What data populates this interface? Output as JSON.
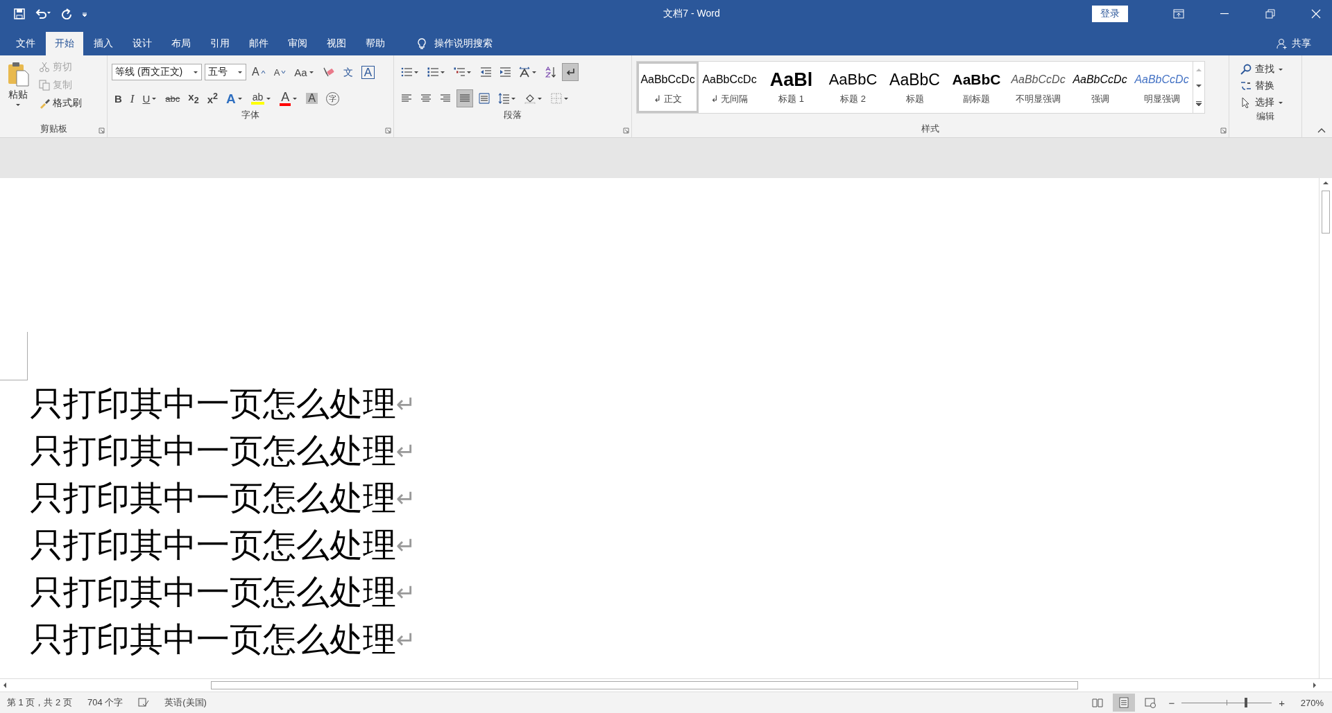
{
  "title_bar": {
    "title": "文档7  -  Word",
    "sign_in": "登录"
  },
  "tabs": [
    {
      "label": "文件",
      "selected": false
    },
    {
      "label": "开始",
      "selected": true
    },
    {
      "label": "插入",
      "selected": false
    },
    {
      "label": "设计",
      "selected": false
    },
    {
      "label": "布局",
      "selected": false
    },
    {
      "label": "引用",
      "selected": false
    },
    {
      "label": "邮件",
      "selected": false
    },
    {
      "label": "审阅",
      "selected": false
    },
    {
      "label": "视图",
      "selected": false
    },
    {
      "label": "帮助",
      "selected": false
    }
  ],
  "tell_me": {
    "placeholder": "操作说明搜索"
  },
  "share": "共享",
  "clipboard": {
    "paste": "粘贴",
    "small": [
      {
        "kind": "cut",
        "label": "剪切",
        "disabled": true
      },
      {
        "kind": "copy",
        "label": "复制",
        "disabled": true
      },
      {
        "kind": "painter",
        "label": "格式刷",
        "disabled": false
      }
    ],
    "group_label": "剪贴板"
  },
  "font": {
    "font_name": "等线 (西文正文)",
    "font_size": "五号",
    "group_label": "字体",
    "row1": [
      {
        "kind": "grow",
        "glyph": "A"
      },
      {
        "kind": "shrink",
        "glyph": "A"
      },
      {
        "kind": "case",
        "glyph": "Aa",
        "dropdown": true
      },
      {
        "kind": "clear"
      },
      {
        "kind": "phonetic",
        "glyph": "文"
      },
      {
        "kind": "boxed",
        "glyph": "A"
      }
    ],
    "row2": [
      {
        "kind": "bold",
        "glyph": "B"
      },
      {
        "kind": "italic",
        "glyph": "I"
      },
      {
        "kind": "underline",
        "glyph": "U",
        "dropdown": true
      },
      {
        "kind": "strike",
        "glyph": "abc"
      },
      {
        "kind": "script",
        "glyph": "x$_{2}$"
      },
      {
        "kind": "script",
        "glyph": "x$^{2}$"
      },
      {
        "kind": "effect",
        "glyph": "A",
        "dropdown": true
      },
      {
        "kind": "highlight",
        "glyph": "ab",
        "color": "#ffff00",
        "dropdown": true
      },
      {
        "kind": "fontcolor",
        "glyph": "A",
        "color": "#ff0000",
        "dropdown": true
      },
      {
        "kind": "shade",
        "glyph": "A"
      },
      {
        "kind": "circled",
        "glyph": "字"
      }
    ]
  },
  "paragraph": {
    "group_label": "段落",
    "row1": [
      {
        "kind": "bullets",
        "dropdown": true,
        "on": false
      },
      {
        "kind": "numbering",
        "dropdown": true,
        "on": false
      },
      {
        "kind": "multilevel",
        "dropdown": true,
        "on": false
      },
      {
        "kind": "outdent",
        "dropdown": false,
        "on": false
      },
      {
        "kind": "indent",
        "dropdown": false,
        "on": false
      },
      {
        "kind": "asian",
        "dropdown": true,
        "on": false
      },
      {
        "kind": "sort",
        "dropdown": false,
        "on": false
      },
      {
        "kind": "marks",
        "dropdown": false,
        "on": true
      }
    ],
    "row2": [
      {
        "kind": "left",
        "dropdown": false,
        "on": false
      },
      {
        "kind": "center",
        "dropdown": false,
        "on": false
      },
      {
        "kind": "right",
        "dropdown": false,
        "on": false
      },
      {
        "kind": "justify",
        "dropdown": false,
        "on": true
      },
      {
        "kind": "distributed",
        "dropdown": false,
        "on": false
      },
      {
        "kind": "spacing",
        "dropdown": true,
        "on": false
      },
      {
        "kind": "shading",
        "dropdown": true,
        "on": false
      },
      {
        "kind": "borders",
        "dropdown": true,
        "on": false
      }
    ]
  },
  "styles": {
    "group_label": "样式",
    "items": [
      {
        "kind": "normal",
        "sample": "AaBbCcDc",
        "label": "正文",
        "mark": "↲",
        "selected": true
      },
      {
        "kind": "nospacing",
        "sample": "AaBbCcDc",
        "label": "无间隔",
        "mark": "↲",
        "selected": false
      },
      {
        "kind": "heading1",
        "sample": "AaBl",
        "label": "标题 1",
        "selected": false
      },
      {
        "kind": "heading2",
        "sample": "AaBbC",
        "label": "标题 2",
        "selected": false
      },
      {
        "kind": "title",
        "sample": "AaBbC",
        "label": "标题",
        "selected": false
      },
      {
        "kind": "subtitle",
        "sample": "AaBbC",
        "label": "副标题",
        "selected": false
      },
      {
        "kind": "subtle",
        "sample": "AaBbCcDc",
        "label": "不明显强调",
        "selected": false
      },
      {
        "kind": "emphasis",
        "sample": "AaBbCcDc",
        "label": "强调",
        "selected": false
      },
      {
        "kind": "intense",
        "sample": "AaBbCcDc",
        "label": "明显强调",
        "selected": false
      }
    ]
  },
  "editing": {
    "group_label": "编辑",
    "items": [
      {
        "kind": "find",
        "label": "查找",
        "dropdown": true
      },
      {
        "kind": "replace",
        "label": "替换",
        "dropdown": false
      },
      {
        "kind": "select",
        "label": "选择",
        "dropdown": true
      }
    ]
  },
  "document": {
    "lines": [
      {
        "text": "只打印其中一页怎么处理",
        "mark": "↵"
      },
      {
        "text": "只打印其中一页怎么处理",
        "mark": "↵"
      },
      {
        "text": "只打印其中一页怎么处理",
        "mark": "↵"
      },
      {
        "text": "只打印其中一页怎么处理",
        "mark": "↵"
      },
      {
        "text": "只打印其中一页怎么处理",
        "mark": "↵"
      },
      {
        "text": "只打印其中一页怎么处理",
        "mark": "↵"
      }
    ]
  },
  "status_bar": {
    "page": "第 1 页，共 2 页",
    "words": "704 个字",
    "language": "英语(美国)",
    "views": [
      {
        "kind": "read",
        "selected": false
      },
      {
        "kind": "print",
        "selected": true
      },
      {
        "kind": "web",
        "selected": false
      }
    ],
    "zoom_out": "−",
    "zoom_in": "+",
    "zoom": {
      "level": 0.7
    },
    "zoom_text": "270%"
  }
}
